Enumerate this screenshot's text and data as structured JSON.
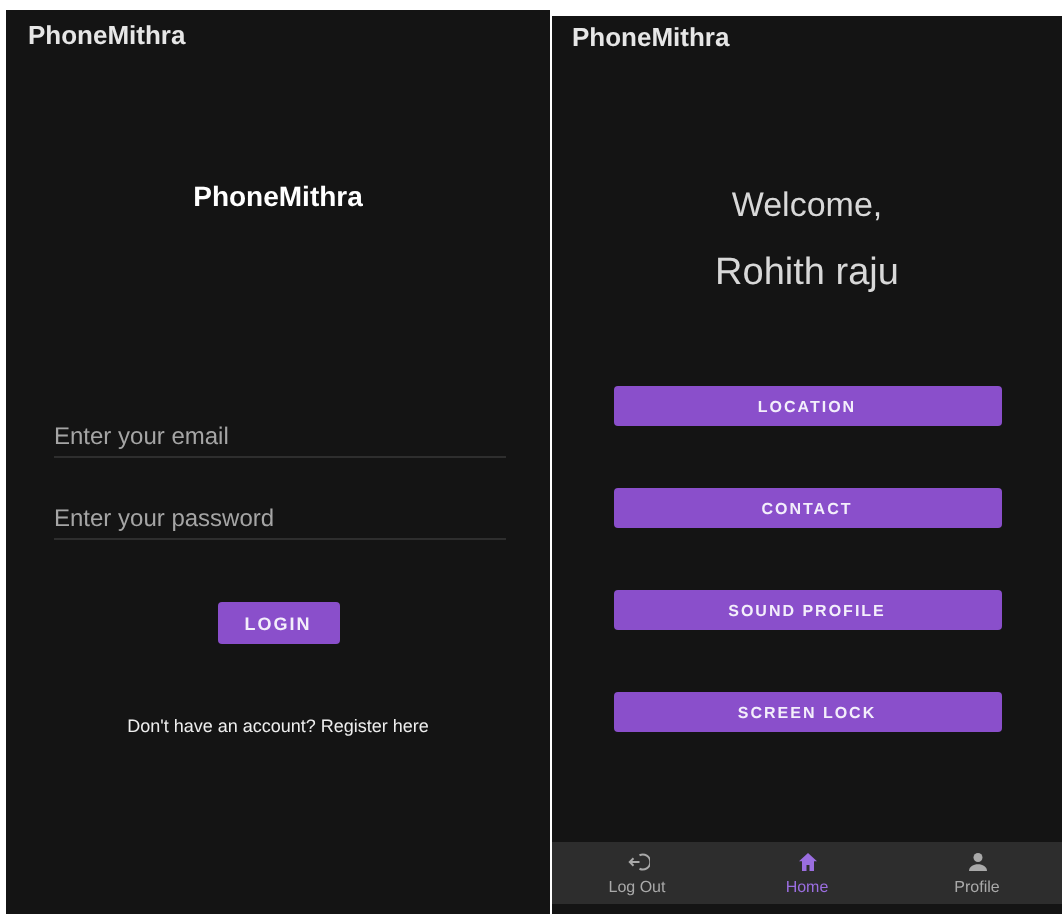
{
  "login_screen": {
    "app_bar": {
      "title": "PhoneMithra"
    },
    "logo": "PhoneMithra",
    "email_field": {
      "placeholder": "Enter your email"
    },
    "password_field": {
      "placeholder": "Enter your password"
    },
    "login_button": "LOGIN",
    "register_link": "Don't have an account? Register here"
  },
  "home_screen": {
    "app_bar": {
      "title": "PhoneMithra"
    },
    "greeting": "Welcome,",
    "user_name": "Rohith raju",
    "buttons": [
      "LOCATION",
      "CONTACT",
      "SOUND PROFILE",
      "SCREEN LOCK"
    ],
    "bottom_nav": [
      {
        "label": "Log Out",
        "kind": "logout",
        "selected": false
      },
      {
        "label": "Home",
        "kind": "home",
        "selected": true
      },
      {
        "label": "Profile",
        "kind": "profile",
        "selected": false
      }
    ]
  }
}
